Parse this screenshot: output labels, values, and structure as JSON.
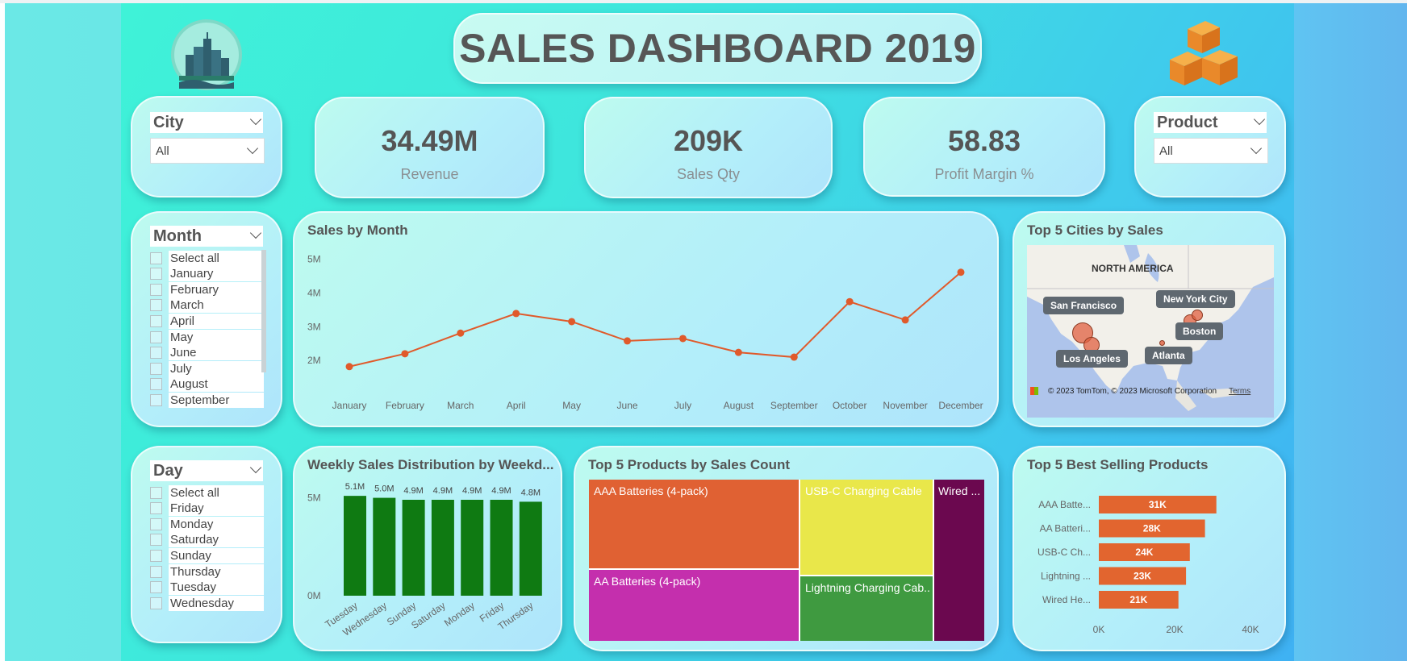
{
  "header": {
    "title": "SALES DASHBOARD 2019"
  },
  "icons": {
    "left_logo": "city-skyline-icon",
    "right_logo": "stacked-boxes-icon"
  },
  "kpis": [
    {
      "value": "34.49M",
      "label": "Revenue"
    },
    {
      "value": "209K",
      "label": "Sales Qty"
    },
    {
      "value": "58.83",
      "label": "Profit Margin %"
    }
  ],
  "slicers": {
    "city": {
      "title": "City",
      "selected": "All"
    },
    "product": {
      "title": "Product",
      "selected": "All"
    },
    "month": {
      "title": "Month",
      "items": [
        "Select all",
        "January",
        "February",
        "March",
        "April",
        "May",
        "June",
        "July",
        "August",
        "September"
      ]
    },
    "day": {
      "title": "Day",
      "items": [
        "Select all",
        "Friday",
        "Monday",
        "Saturday",
        "Sunday",
        "Thursday",
        "Tuesday",
        "Wednesday"
      ]
    }
  },
  "sales_by_month": {
    "title": "Sales by Month",
    "y_ticks": [
      "5M",
      "4M",
      "3M",
      "2M"
    ]
  },
  "map": {
    "title": "Top 5 Cities by Sales",
    "region_label": "NORTH AMERICA",
    "cities": [
      "San Francisco",
      "New York City",
      "Boston",
      "Atlanta",
      "Los Angeles"
    ],
    "copyright": "© 2023 TomTom, © 2023 Microsoft Corporation",
    "terms": "Terms"
  },
  "weekly": {
    "title": "Weekly Sales Distribution by Weekd...",
    "y_ticks": [
      "5M",
      "0M"
    ]
  },
  "treemap": {
    "title": "Top 5 Products by Sales Count",
    "tiles": [
      {
        "label": "AAA Batteries (4-pack)",
        "color": "#e06133"
      },
      {
        "label": "AA Batteries (4-pack)",
        "color": "#c42fad"
      },
      {
        "label": "USB-C Charging Cable",
        "color": "#e9e74a"
      },
      {
        "label": "Lightning Charging Cab...",
        "color": "#3f9a40"
      },
      {
        "label": "Wired ...",
        "color": "#6b084f"
      }
    ]
  },
  "best_selling": {
    "title": "Top 5 Best Selling Products",
    "x_ticks": [
      "0K",
      "20K",
      "40K"
    ]
  },
  "colors": {
    "line": "#e05a2b",
    "weekly_bar": "#0f7a12",
    "best_bar": "#e2652f"
  },
  "chart_data": [
    {
      "type": "line",
      "title": "Sales by Month",
      "x": [
        "January",
        "February",
        "March",
        "April",
        "May",
        "June",
        "July",
        "August",
        "September",
        "October",
        "November",
        "December"
      ],
      "series": [
        {
          "values": [
            1.82,
            2.2,
            2.81,
            3.39,
            3.15,
            2.58,
            2.65,
            2.24,
            2.1,
            3.74,
            3.2,
            4.61
          ]
        }
      ],
      "ylim": [
        1.6,
        5.2
      ],
      "y_unit": "M"
    },
    {
      "type": "bar",
      "title": "Weekly Sales Distribution by Weekd...",
      "categories": [
        "Tuesday",
        "Wednesday",
        "Sunday",
        "Saturday",
        "Monday",
        "Friday",
        "Thursday"
      ],
      "values": [
        5.1,
        5.0,
        4.9,
        4.9,
        4.9,
        4.9,
        4.8
      ],
      "data_labels": [
        "5.1M",
        "5.0M",
        "4.9M",
        "4.9M",
        "4.9M",
        "4.9M",
        "4.8M"
      ],
      "ylim": [
        0,
        5.6
      ]
    },
    {
      "type": "bar",
      "orientation": "horizontal",
      "title": "Top 5 Best Selling Products",
      "categories": [
        "AAA Batte...",
        "AA Batteri...",
        "USB-C Ch...",
        "Lightning ...",
        "Wired He..."
      ],
      "values": [
        31,
        28,
        24,
        23,
        21
      ],
      "data_labels": [
        "31K",
        "28K",
        "24K",
        "23K",
        "21K"
      ],
      "xlim": [
        0,
        40
      ]
    }
  ]
}
